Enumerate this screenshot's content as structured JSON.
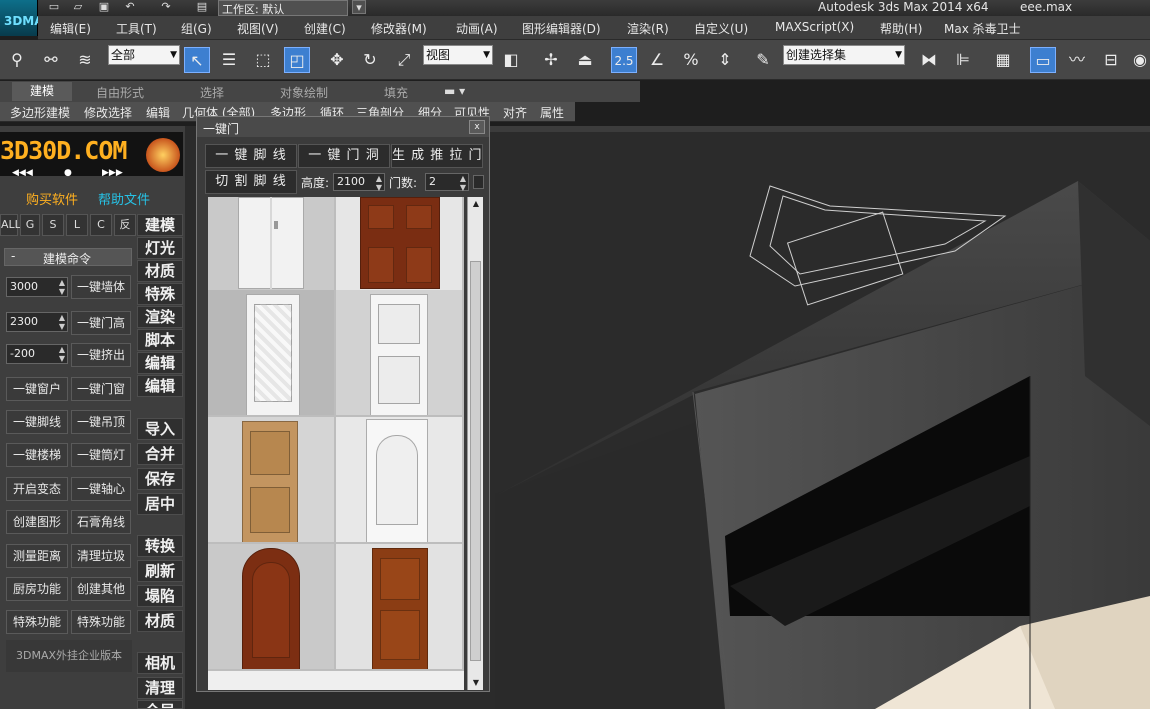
{
  "window": {
    "app_logo": "3DMAX",
    "title": "Autodesk 3ds Max  2014 x64",
    "filename": "eee.max",
    "workspace_label": "工作区: 默认"
  },
  "menu": [
    "编辑(E)",
    "工具(T)",
    "组(G)",
    "视图(V)",
    "创建(C)",
    "修改器(M)",
    "动画(A)",
    "图形编辑器(D)",
    "渲染(R)",
    "自定义(U)",
    "MAXScript(X)",
    "帮助(H)",
    "Max 杀毒卫士"
  ],
  "toolbar": {
    "selection_filter": "全部",
    "coord_system": "视图",
    "snap_value": "2.5",
    "named_selection": "创建选择集",
    "icons": [
      "link-icon",
      "unlink-icon",
      "bind-spacewarp-icon",
      "select-object-icon",
      "select-by-name-icon",
      "rect-region-icon",
      "window-crossing-icon",
      "move-icon",
      "rotate-icon",
      "scale-icon",
      "pivot-icon",
      "manipulate-icon",
      "keyboard-shortcut-icon",
      "snap-toggle-icon",
      "angle-snap-icon",
      "percent-snap-icon",
      "spinner-snap-icon",
      "edit-named-selection-icon",
      "mirror-icon",
      "align-icon",
      "layer-icon",
      "scene-explorer-icon",
      "curve-editor-icon",
      "schematic-view-icon",
      "render-setup-icon"
    ]
  },
  "ribbon": {
    "tabs": [
      "建模",
      "自由形式",
      "选择",
      "对象绘制",
      "填充"
    ],
    "active_tab": "建模",
    "subtabs": [
      "多边形建模",
      "修改选择",
      "编辑",
      "几何体 (全部)",
      "多边形",
      "循环",
      "三角剖分",
      "细分",
      "可见性",
      "对齐",
      "属性"
    ]
  },
  "left_panel": {
    "brand": "3D30D.COM",
    "nav": [
      "◀◀◀",
      "●",
      "▶▶▶"
    ],
    "buy_software": "购买软件",
    "help_file": "帮助文件",
    "filters": [
      "ALL",
      "G",
      "S",
      "L",
      "C",
      "反"
    ],
    "command_header": "建模命令",
    "command_header_toggle": "-",
    "fields": [
      {
        "value": "3000",
        "button": "一键墙体"
      },
      {
        "value": "2300",
        "button": "一键门高"
      },
      {
        "value": "-200",
        "button": "一键挤出"
      }
    ],
    "buttons": [
      [
        "一键窗户",
        "一键门窗"
      ],
      [
        "一键脚线",
        "一键吊顶"
      ],
      [
        "一键楼梯",
        "一键筒灯"
      ],
      [
        "开启变态",
        "一键轴心"
      ],
      [
        "创建图形",
        "石膏角线"
      ],
      [
        "测量距离",
        "清理垃圾"
      ],
      [
        "厨房功能",
        "创建其他"
      ],
      [
        "特殊功能",
        "特殊功能"
      ]
    ],
    "footer": "3DMAX外挂企业版本",
    "categories": [
      "建模",
      "灯光",
      "材质",
      "特殊",
      "渲染",
      "脚本",
      "编辑",
      "编辑",
      "导入",
      "合并",
      "保存",
      "居中",
      "转换",
      "刷新",
      "塌陷",
      "材质",
      "相机",
      "清理",
      "全局"
    ]
  },
  "dialog": {
    "title": "一键门",
    "close": "x",
    "buttons": [
      "一 键 脚 线",
      "一 键 门 洞",
      "生 成 推 拉 门",
      "切 割 脚 线"
    ],
    "height_label": "高度:",
    "height_value": "2100",
    "door_count_label": "门数:",
    "door_count_value": "2",
    "doors": [
      "white-double-door",
      "mahogany-panel-door",
      "white-carved-door",
      "white-panel-door",
      "oak-panel-door",
      "white-arched-door",
      "mahogany-arched-door",
      "walnut-panel-door"
    ]
  }
}
